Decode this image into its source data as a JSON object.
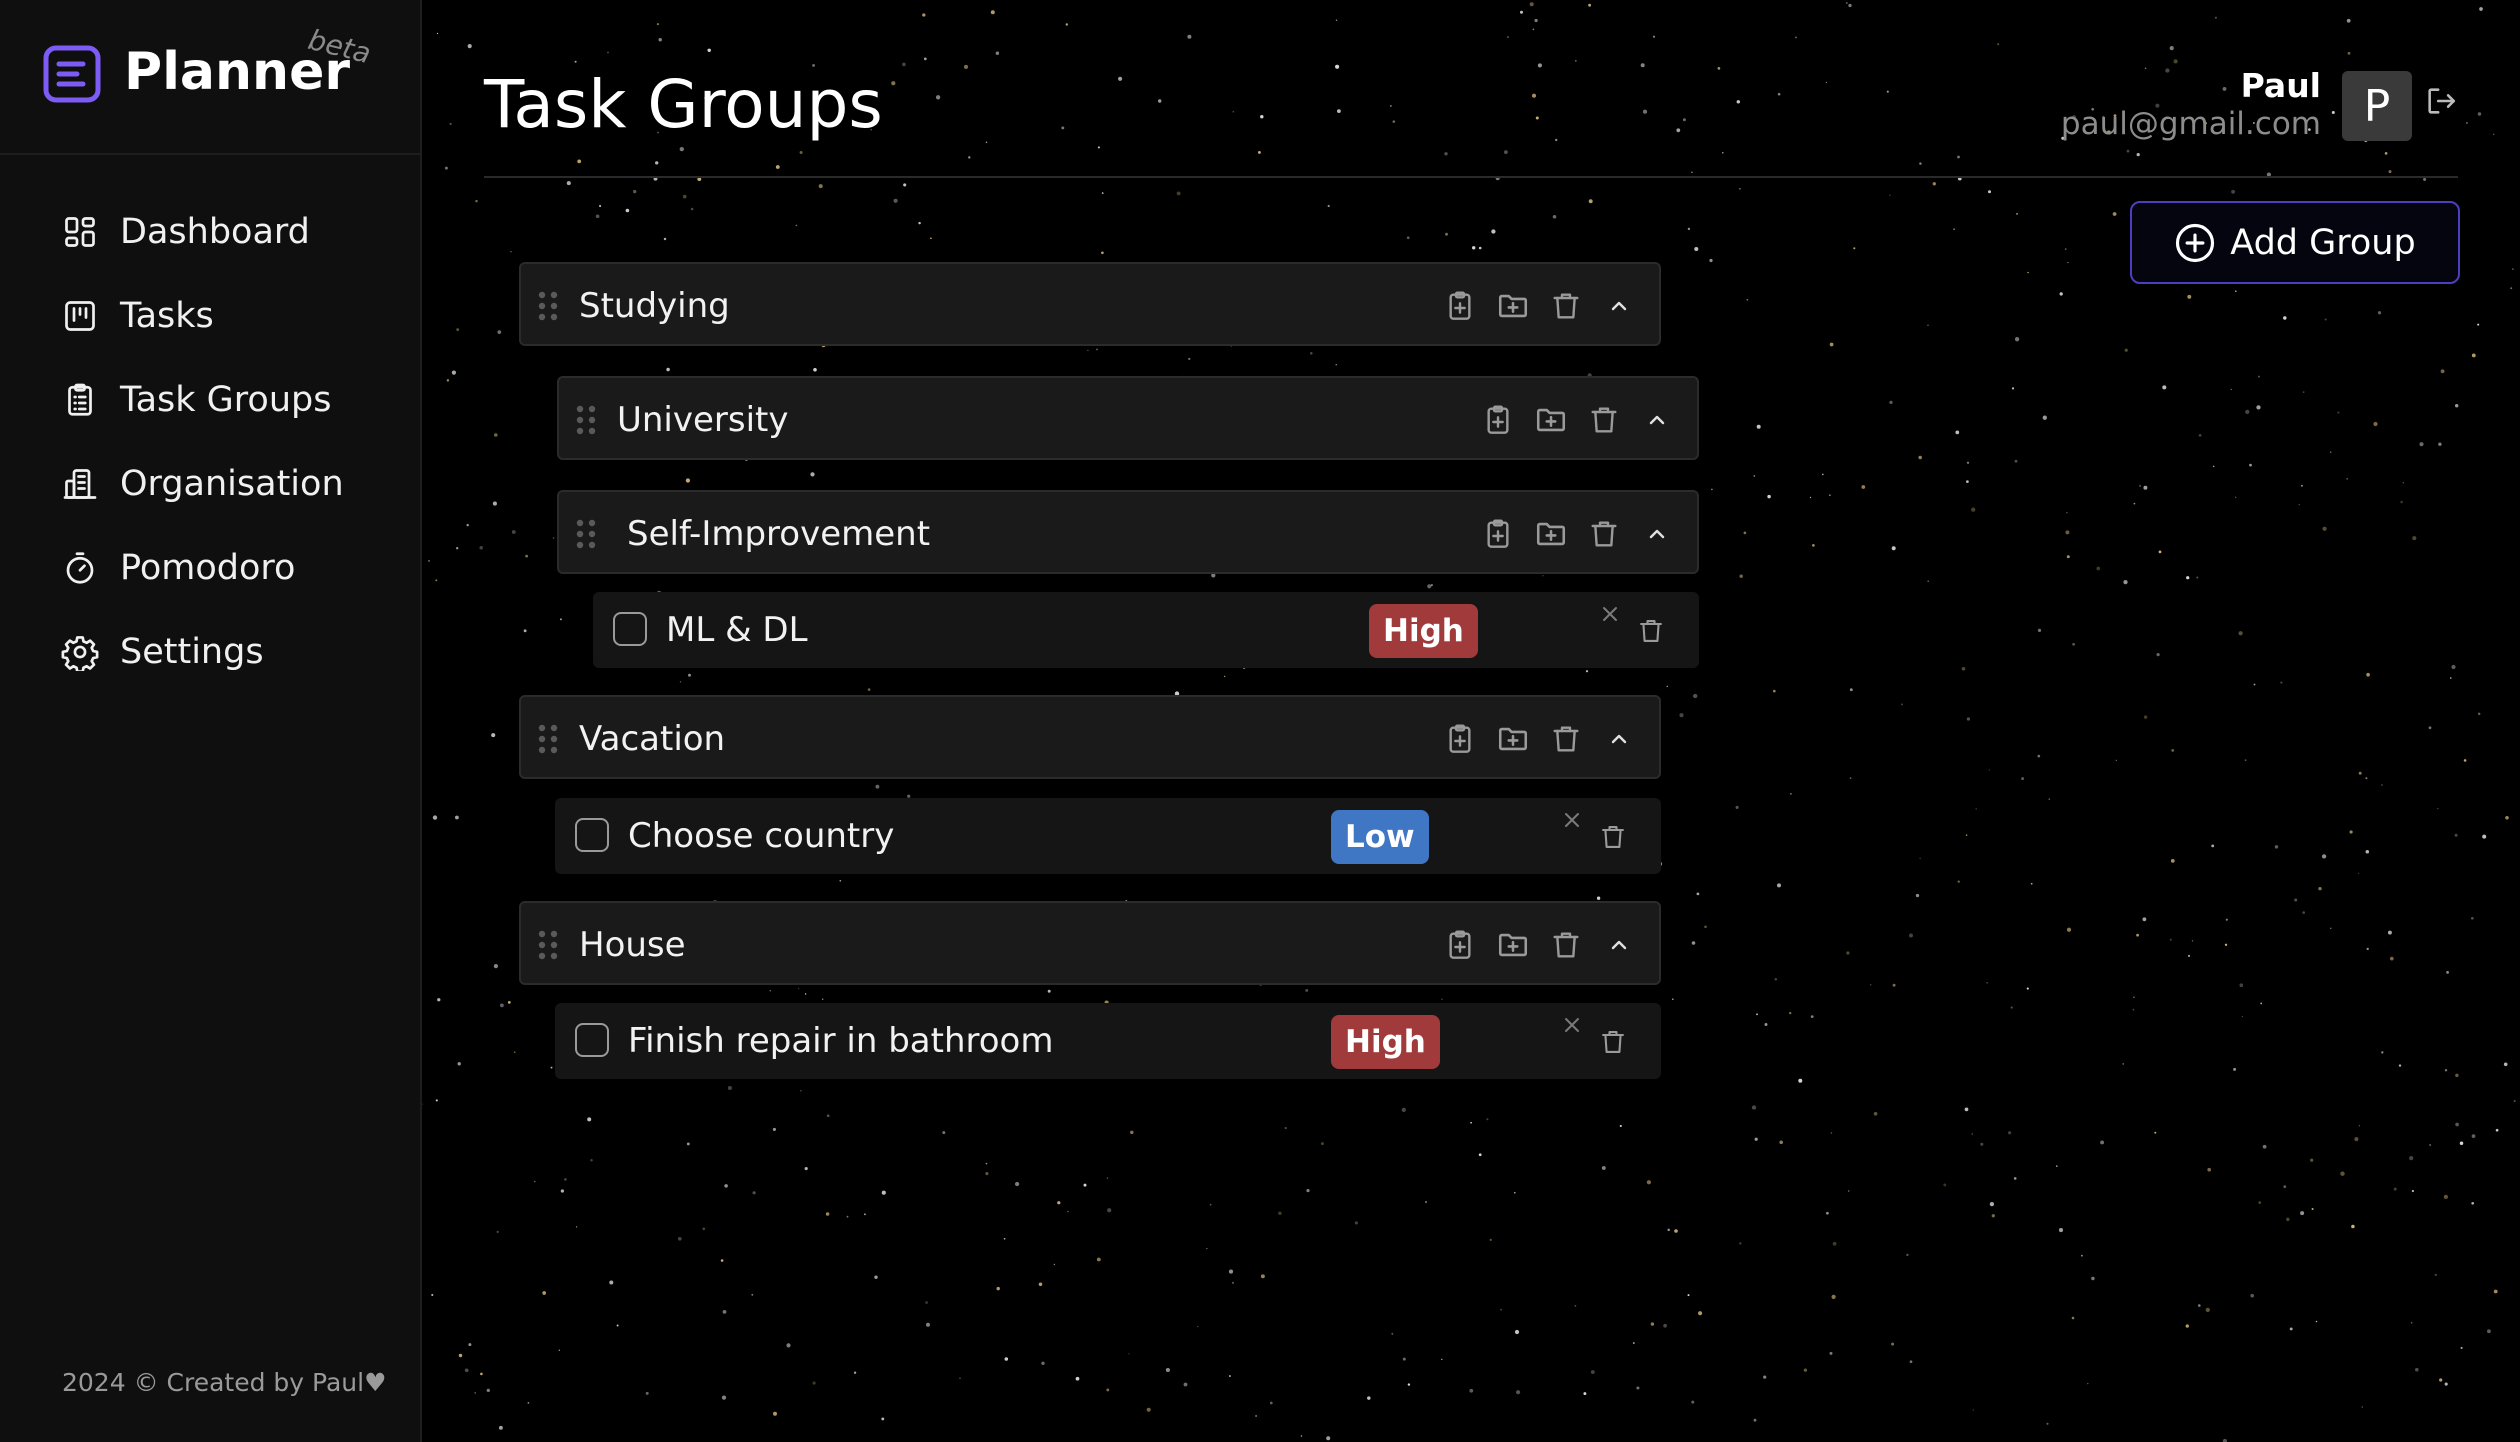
{
  "app": {
    "name": "Planner",
    "badge": "beta"
  },
  "sidebar": {
    "items": [
      {
        "label": "Dashboard",
        "icon": "dashboard-icon"
      },
      {
        "label": "Tasks",
        "icon": "kanban-icon"
      },
      {
        "label": "Task Groups",
        "icon": "clipboard-list-icon"
      },
      {
        "label": "Organisation",
        "icon": "building-icon"
      },
      {
        "label": "Pomodoro",
        "icon": "timer-icon"
      },
      {
        "label": "Settings",
        "icon": "gear-icon"
      }
    ],
    "footer": "2024 © Created by Paul♥"
  },
  "header": {
    "title": "Task Groups"
  },
  "user": {
    "name": "Paul",
    "email": "paul@gmail.com",
    "initial": "P"
  },
  "actions": {
    "add_group": "Add Group"
  },
  "groups": [
    {
      "title": "Studying"
    },
    {
      "title": "University"
    },
    {
      "title": "Self-Improvement"
    },
    {
      "title": "Vacation"
    },
    {
      "title": "House"
    }
  ],
  "tasks": [
    {
      "title": "ML & DL",
      "priority": "High"
    },
    {
      "title": "Choose country",
      "priority": "Low"
    },
    {
      "title": "Finish repair in bathroom",
      "priority": "High"
    }
  ],
  "colors": {
    "accent": "#7c5cf5",
    "high": "#a13b3b",
    "low": "#3f77c4",
    "background": "#000000",
    "sidebar": "#0f0f0f"
  }
}
